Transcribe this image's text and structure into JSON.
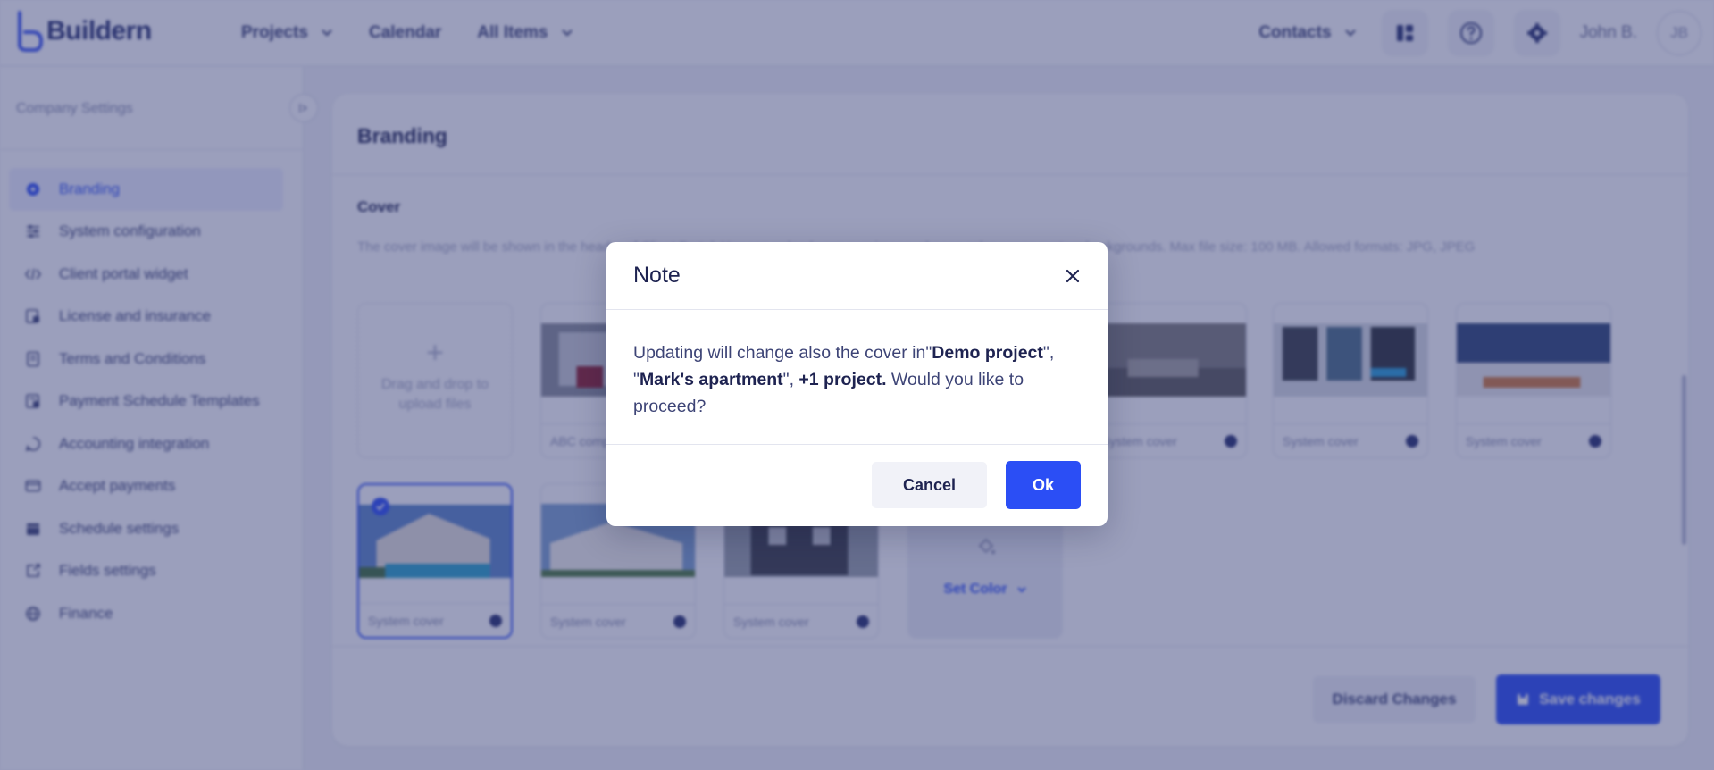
{
  "header": {
    "logo_text": "Buildern",
    "nav": [
      {
        "label": "Projects",
        "has_dropdown": true
      },
      {
        "label": "Calendar",
        "has_dropdown": false
      },
      {
        "label": "All Items",
        "has_dropdown": true
      }
    ],
    "contacts_label": "Contacts",
    "user_name": "John B.",
    "user_initials": "JB"
  },
  "sidebar": {
    "title": "Company Settings",
    "items": [
      {
        "label": "Branding",
        "icon": "gear-icon",
        "active": true
      },
      {
        "label": "System configuration",
        "icon": "sliders-icon"
      },
      {
        "label": "Client portal widget",
        "icon": "code-icon"
      },
      {
        "label": "License and insurance",
        "icon": "license-icon"
      },
      {
        "label": "Terms and Conditions",
        "icon": "document-icon"
      },
      {
        "label": "Payment Schedule Templates",
        "icon": "payment-schedule-icon"
      },
      {
        "label": "Accounting integration",
        "icon": "accounting-icon"
      },
      {
        "label": "Accept payments",
        "icon": "credit-card-icon"
      },
      {
        "label": "Schedule settings",
        "icon": "calendar-icon"
      },
      {
        "label": "Fields settings",
        "icon": "fields-icon"
      },
      {
        "label": "Finance",
        "icon": "globe-icon"
      }
    ]
  },
  "main": {
    "title": "Branding",
    "cover": {
      "section_title": "Cover",
      "description": "The cover image will be shown in the header of Client Portal. You can upload your own image, choose color or use system backgrounds. Max file size: 100 MB. Allowed formats: JPG, JPEG",
      "upload_text": "Drag and drop to upload files",
      "tiles": [
        {
          "label": "ABC company cover"
        },
        {
          "label": "System cover"
        },
        {
          "label": "System cover"
        },
        {
          "label": "System cover"
        },
        {
          "label": "System cover",
          "selected": true
        },
        {
          "label": "System cover"
        },
        {
          "label": "System cover"
        }
      ],
      "set_color_label": "Set Color"
    },
    "discard_label": "Discard Changes",
    "save_label": "Save changes"
  },
  "modal": {
    "title": "Note",
    "message_prefix": "Updating will change also the cover in\"",
    "project_1": "Demo project",
    "sep": "\", \"",
    "project_2": "Mark's apartment",
    "sep2": "\", ",
    "extra": "+1 project.",
    "message_suffix": " Would you like to proceed?",
    "cancel_label": "Cancel",
    "ok_label": "Ok"
  },
  "colors": {
    "accent": "#2b4ef5",
    "text_dark": "#1e2351",
    "overlay": "#2e3673"
  }
}
